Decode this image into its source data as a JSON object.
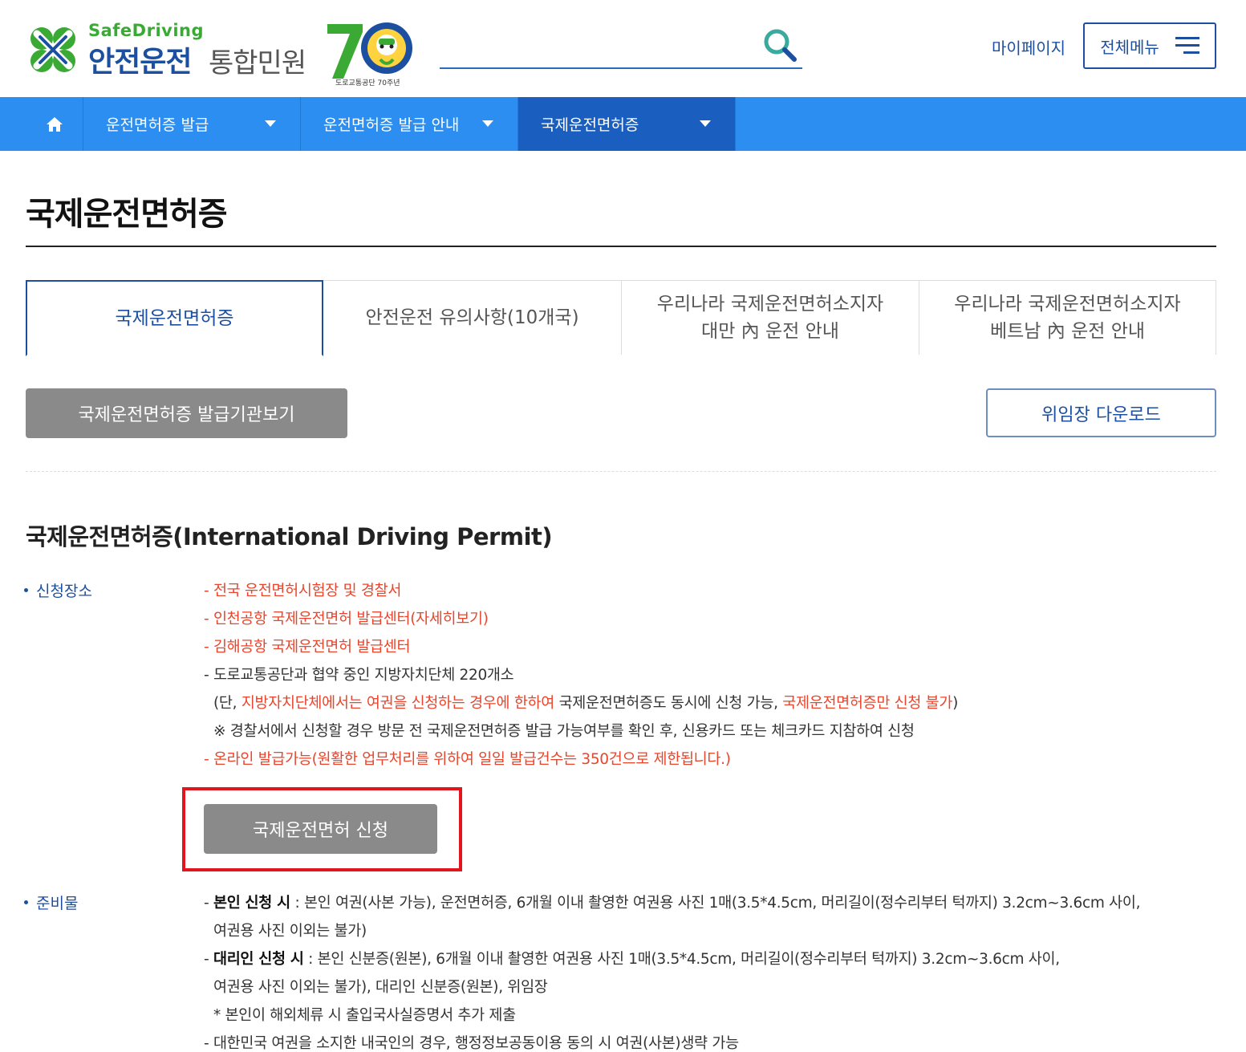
{
  "header": {
    "logo_safe": "SafeDriving",
    "logo_title_1": "안전운전",
    "logo_title_2": "통합민원",
    "logo_anniv": "도로교통공단 70주년",
    "mypage": "마이페이지",
    "allmenu": "전체메뉴",
    "colors": {
      "brand_blue": "#1d4fa0",
      "brand_green": "#3aaa35"
    }
  },
  "nav": {
    "items": [
      {
        "label": "운전면허증 발급"
      },
      {
        "label": "운전면허증 발급 안내"
      },
      {
        "label": "국제운전면허증"
      }
    ],
    "colors": {
      "bar": "#2b8ef0",
      "active": "#1a5fc0"
    }
  },
  "page": {
    "title": "국제운전면허증"
  },
  "tabs": [
    {
      "line1": "국제운전면허증",
      "line2": ""
    },
    {
      "line1": "안전운전 유의사항(10개국)",
      "line2": ""
    },
    {
      "line1": "우리나라 국제운전면허소지자",
      "line2": "대만 內 운전 안내"
    },
    {
      "line1": "우리나라 국제운전면허소지자",
      "line2": "베트남 內 운전 안내"
    }
  ],
  "buttons": {
    "issuers": "국제운전면허증 발급기관보기",
    "download": "위임장 다운로드",
    "apply": "국제운전면허 신청"
  },
  "section": {
    "title": "국제운전면허증(International Driving Permit)",
    "place_label": "신청장소",
    "place_lines": {
      "l1": "- 전국 운전면허시험장 및 경찰서",
      "l2": "- 인천공항 국제운전면허 발급센터(자세히보기)",
      "l3": "- 김해공항 국제운전면허 발급센터",
      "l4": "- 도로교통공단과 협약 중인 지방자치단체 220개소",
      "l5a": "(단, ",
      "l5b": "지방자치단체에서는 여권을 신청하는 경우에 한하여",
      "l5c": " 국제운전면허증도 동시에 신청 가능, ",
      "l5d": "국제운전면허증만 신청 불가",
      "l5e": ")",
      "l6": "※ 경찰서에서 신청할 경우 방문 전 국제운전면허증 발급 가능여부를 확인 후, 신용카드 또는 체크카드 지참하여 신청",
      "l7": "- 온라인 발급가능(원활한 업무처리를 위하여 일일 발급건수는 350건으로 제한됩니다.)"
    },
    "prep_label": "준비물",
    "prep_lines": {
      "p1a": "- ",
      "p1b": "본인 신청 시",
      "p1c": " : 본인 여권(사본 가능), 운전면허증, 6개월 이내 촬영한 여권용 사진 1매(3.5*4.5cm, 머리길이(정수리부터 턱까지) 3.2cm~3.6cm 사이,",
      "p2": "여권용 사진 이외는 불가)",
      "p3a": "- ",
      "p3b": "대리인 신청 시",
      "p3c": " : 본인 신분증(원본), 6개월 이내 촬영한 여권용 사진 1매(3.5*4.5cm, 머리길이(정수리부터 턱까지) 3.2cm~3.6cm 사이,",
      "p4": "여권용 사진 이외는 불가), 대리인 신분증(원본), 위임장",
      "p5": "* 본인이 해외체류 시 출입국사실증명서 추가 제출",
      "p6": "- 대한민국 여권을 소지한 내국인의 경우, 행정정보공동이용 동의 시 여권(사본)생략 가능"
    },
    "colors": {
      "highlight": "#e8452c",
      "apply_box": "#e2141c"
    }
  }
}
